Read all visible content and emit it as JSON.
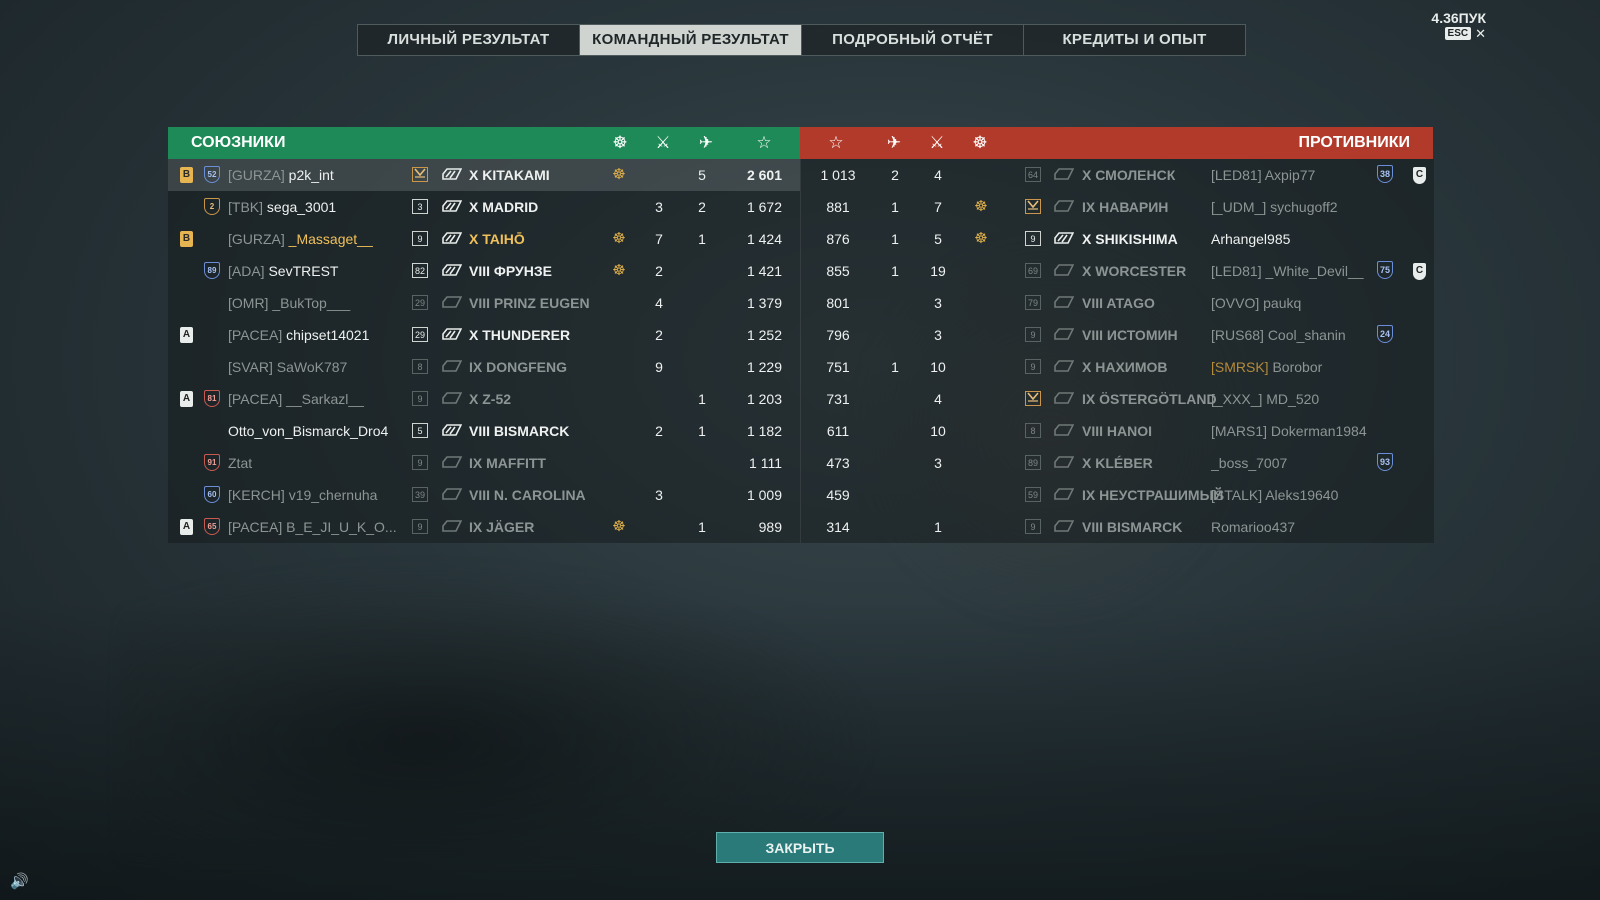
{
  "version": "4.36ПУК",
  "esc_label": "ESC",
  "tabs": [
    {
      "label": "ЛИЧНЫЙ РЕЗУЛЬТАТ",
      "active": false
    },
    {
      "label": "КОМАНДНЫЙ РЕЗУЛЬТАТ",
      "active": true
    },
    {
      "label": "ПОДРОБНЫЙ ОТЧЁТ",
      "active": false
    },
    {
      "label": "КРЕДИТЫ И ОПЫТ",
      "active": false
    }
  ],
  "allies_title": "СОЮЗНИКИ",
  "enemies_title": "ПРОТИВНИКИ",
  "close_label": "ЗАКРЫТЬ",
  "colors": {
    "ally_header": "#1d8a57",
    "enemy_header": "#b23a2a",
    "accent_gold": "#f0c15a"
  },
  "allies": [
    {
      "div": "B",
      "div_color": "gold",
      "rank": "52",
      "rank_color": "blue",
      "clan": "[GURZA]",
      "name": "p2k_int",
      "name_style": "white",
      "tier_box": "v",
      "tier_style": "gold",
      "class_lit": true,
      "ship": "X KITAKAMI",
      "ship_style": "white",
      "medal": true,
      "frags": "",
      "planes": "5",
      "xp": "2 601",
      "xp_bold": true,
      "me": true
    },
    {
      "div": "",
      "div_color": "",
      "rank": "2",
      "rank_color": "gold",
      "clan": "[TBK]",
      "name": "sega_3001",
      "name_style": "white",
      "tier_box": "3",
      "tier_style": "lit",
      "class_lit": true,
      "ship": "X MADRID",
      "ship_style": "white",
      "medal": false,
      "frags": "3",
      "planes": "2",
      "xp": "1 672"
    },
    {
      "div": "B",
      "div_color": "gold",
      "rank": "",
      "rank_color": "",
      "clan": "[GURZA]",
      "name": "_Massaget__",
      "name_style": "gold",
      "tier_box": "9",
      "tier_style": "lit",
      "class_lit": true,
      "ship": "X TAIHŌ",
      "ship_style": "gold",
      "medal": true,
      "frags": "7",
      "planes": "1",
      "xp": "1 424"
    },
    {
      "div": "",
      "div_color": "",
      "rank": "89",
      "rank_color": "blue",
      "clan": "[ADA]",
      "name": "SevTREST",
      "name_style": "white",
      "tier_box": "82",
      "tier_style": "lit",
      "class_lit": true,
      "ship": "VIII ФРУНЗЕ",
      "ship_style": "white",
      "medal": true,
      "frags": "2",
      "planes": "",
      "xp": "1 421"
    },
    {
      "div": "",
      "div_color": "",
      "rank": "",
      "rank_color": "",
      "clan": "[OMR]",
      "name": "_BukTop___",
      "name_style": "dim",
      "tier_box": "29",
      "tier_style": "dim",
      "class_lit": false,
      "ship": "VIII PRINZ EUGEN",
      "ship_style": "dim",
      "medal": false,
      "frags": "4",
      "planes": "",
      "xp": "1 379"
    },
    {
      "div": "A",
      "div_color": "white",
      "rank": "",
      "rank_color": "",
      "clan": "[PACEA]",
      "name": "chipset14021",
      "name_style": "white",
      "tier_box": "29",
      "tier_style": "lit",
      "class_lit": true,
      "ship": "X THUNDERER",
      "ship_style": "white",
      "medal": false,
      "frags": "2",
      "planes": "",
      "xp": "1 252"
    },
    {
      "div": "",
      "div_color": "",
      "rank": "",
      "rank_color": "",
      "clan": "[SVAR]",
      "name": "SaWoK787",
      "name_style": "dim",
      "tier_box": "8",
      "tier_style": "dim",
      "class_lit": false,
      "ship": "IX DONGFENG",
      "ship_style": "dim",
      "medal": false,
      "frags": "9",
      "planes": "",
      "xp": "1 229"
    },
    {
      "div": "A",
      "div_color": "white",
      "rank": "81",
      "rank_color": "red",
      "clan": "[PACEA]",
      "name": "__Sarkazl__",
      "name_style": "dim",
      "tier_box": "9",
      "tier_style": "dim",
      "class_lit": false,
      "ship": "X Z-52",
      "ship_style": "dim",
      "medal": false,
      "frags": "",
      "planes": "1",
      "xp": "1 203"
    },
    {
      "div": "",
      "div_color": "",
      "rank": "",
      "rank_color": "",
      "clan": "",
      "name": "Otto_von_Bismarck_Dro4",
      "name_style": "white",
      "tier_box": "5",
      "tier_style": "lit",
      "class_lit": true,
      "ship": "VIII BISMARCK",
      "ship_style": "white",
      "medal": false,
      "frags": "2",
      "planes": "1",
      "xp": "1 182"
    },
    {
      "div": "",
      "div_color": "",
      "rank": "91",
      "rank_color": "red",
      "clan": "",
      "name": "Ztat",
      "name_style": "dim",
      "tier_box": "9",
      "tier_style": "dim",
      "class_lit": false,
      "ship": "IX MAFFITT",
      "ship_style": "dim",
      "medal": false,
      "frags": "",
      "planes": "",
      "xp": "1 111"
    },
    {
      "div": "",
      "div_color": "",
      "rank": "60",
      "rank_color": "blue",
      "clan": "[KERCH]",
      "name": "v19_chernuha",
      "name_style": "dim",
      "tier_box": "39",
      "tier_style": "dim",
      "class_lit": false,
      "ship": "VIII N. CAROLINA",
      "ship_style": "dim",
      "medal": false,
      "frags": "3",
      "planes": "",
      "xp": "1 009"
    },
    {
      "div": "A",
      "div_color": "white",
      "rank": "65",
      "rank_color": "red",
      "clan": "[PACEA]",
      "name": "B_E_JI_U_K_O...",
      "name_style": "dim",
      "tier_box": "9",
      "tier_style": "dim",
      "class_lit": false,
      "ship": "IX JÄGER",
      "ship_style": "dim",
      "medal": true,
      "frags": "",
      "planes": "1",
      "xp": "989"
    }
  ],
  "enemies": [
    {
      "xp": "1 013",
      "planes": "2",
      "frags": "4",
      "medal": false,
      "tier_box": "64",
      "tier_style": "dim",
      "class_lit": false,
      "ship": "X СМОЛЕНСК",
      "ship_style": "dim",
      "clan": "[LED81]",
      "clan_style": "dim",
      "name": "Axpip77",
      "name_style": "dim",
      "rank": "38",
      "shield": "C"
    },
    {
      "xp": "881",
      "planes": "1",
      "frags": "7",
      "medal": true,
      "tier_box": "v",
      "tier_style": "gold",
      "class_lit": false,
      "ship": "IX НАВАРИН",
      "ship_style": "dim",
      "clan": "[_UDM_]",
      "clan_style": "dim",
      "name": "sychugoff2",
      "name_style": "dim",
      "rank": "",
      "shield": ""
    },
    {
      "xp": "876",
      "planes": "1",
      "frags": "5",
      "medal": true,
      "tier_box": "9",
      "tier_style": "lit",
      "class_lit": true,
      "ship": "X SHIKISHIMA",
      "ship_style": "white",
      "clan": "",
      "clan_style": "dim",
      "name": "Arhangel985",
      "name_style": "white",
      "rank": "",
      "shield": ""
    },
    {
      "xp": "855",
      "planes": "1",
      "frags": "19",
      "medal": false,
      "tier_box": "69",
      "tier_style": "dim",
      "class_lit": false,
      "ship": "X WORCESTER",
      "ship_style": "dim",
      "clan": "[LED81]",
      "clan_style": "dim",
      "name": "_White_Devil__",
      "name_style": "dim",
      "rank": "75",
      "shield": "C"
    },
    {
      "xp": "801",
      "planes": "",
      "frags": "3",
      "medal": false,
      "tier_box": "79",
      "tier_style": "dim",
      "class_lit": false,
      "ship": "VIII ATAGO",
      "ship_style": "dim",
      "clan": "[OVVO]",
      "clan_style": "dim",
      "name": "paukq",
      "name_style": "dim",
      "rank": "",
      "shield": ""
    },
    {
      "xp": "796",
      "planes": "",
      "frags": "3",
      "medal": false,
      "tier_box": "9",
      "tier_style": "dim",
      "class_lit": false,
      "ship": "VIII ИСТОМИН",
      "ship_style": "dim",
      "clan": "[RUS68]",
      "clan_style": "dim",
      "name": "Cool_shanin",
      "name_style": "dim",
      "rank": "24",
      "shield": ""
    },
    {
      "xp": "751",
      "planes": "1",
      "frags": "10",
      "medal": false,
      "tier_box": "9",
      "tier_style": "dim",
      "class_lit": false,
      "ship": "X НАХИМОВ",
      "ship_style": "dim",
      "clan": "[SMRSK]",
      "clan_style": "gold",
      "name": "Borobor",
      "name_style": "dim",
      "rank": "",
      "shield": ""
    },
    {
      "xp": "731",
      "planes": "",
      "frags": "4",
      "medal": false,
      "tier_box": "v",
      "tier_style": "gold",
      "class_lit": false,
      "ship": "IX ÖSTERGÖTLAND",
      "ship_style": "dim",
      "clan": "[_XXX_]",
      "clan_style": "dim",
      "name": "MD_520",
      "name_style": "dim",
      "rank": "",
      "shield": ""
    },
    {
      "xp": "611",
      "planes": "",
      "frags": "10",
      "medal": false,
      "tier_box": "8",
      "tier_style": "dim",
      "class_lit": false,
      "ship": "VIII HANOI",
      "ship_style": "dim",
      "clan": "[MARS1]",
      "clan_style": "dim",
      "name": "Dokerman1984",
      "name_style": "dim",
      "rank": "",
      "shield": ""
    },
    {
      "xp": "473",
      "planes": "",
      "frags": "3",
      "medal": false,
      "tier_box": "89",
      "tier_style": "dim",
      "class_lit": false,
      "ship": "X KLÉBER",
      "ship_style": "dim",
      "clan": "",
      "clan_style": "dim",
      "name": "_boss_7007",
      "name_style": "dim",
      "rank": "93",
      "shield": ""
    },
    {
      "xp": "459",
      "planes": "",
      "frags": "",
      "medal": false,
      "tier_box": "59",
      "tier_style": "dim",
      "class_lit": false,
      "ship": "IX НЕУСТРАШИМЫЙ",
      "ship_style": "dim",
      "clan": "[STALK]",
      "clan_style": "dim",
      "name": "Aleks19640",
      "name_style": "dim",
      "rank": "",
      "shield": ""
    },
    {
      "xp": "314",
      "planes": "",
      "frags": "1",
      "medal": false,
      "tier_box": "9",
      "tier_style": "dim",
      "class_lit": false,
      "ship": "VIII BISMARCK",
      "ship_style": "dim",
      "clan": "",
      "clan_style": "dim",
      "name": "Romarioo437",
      "name_style": "dim",
      "rank": "",
      "shield": ""
    }
  ]
}
